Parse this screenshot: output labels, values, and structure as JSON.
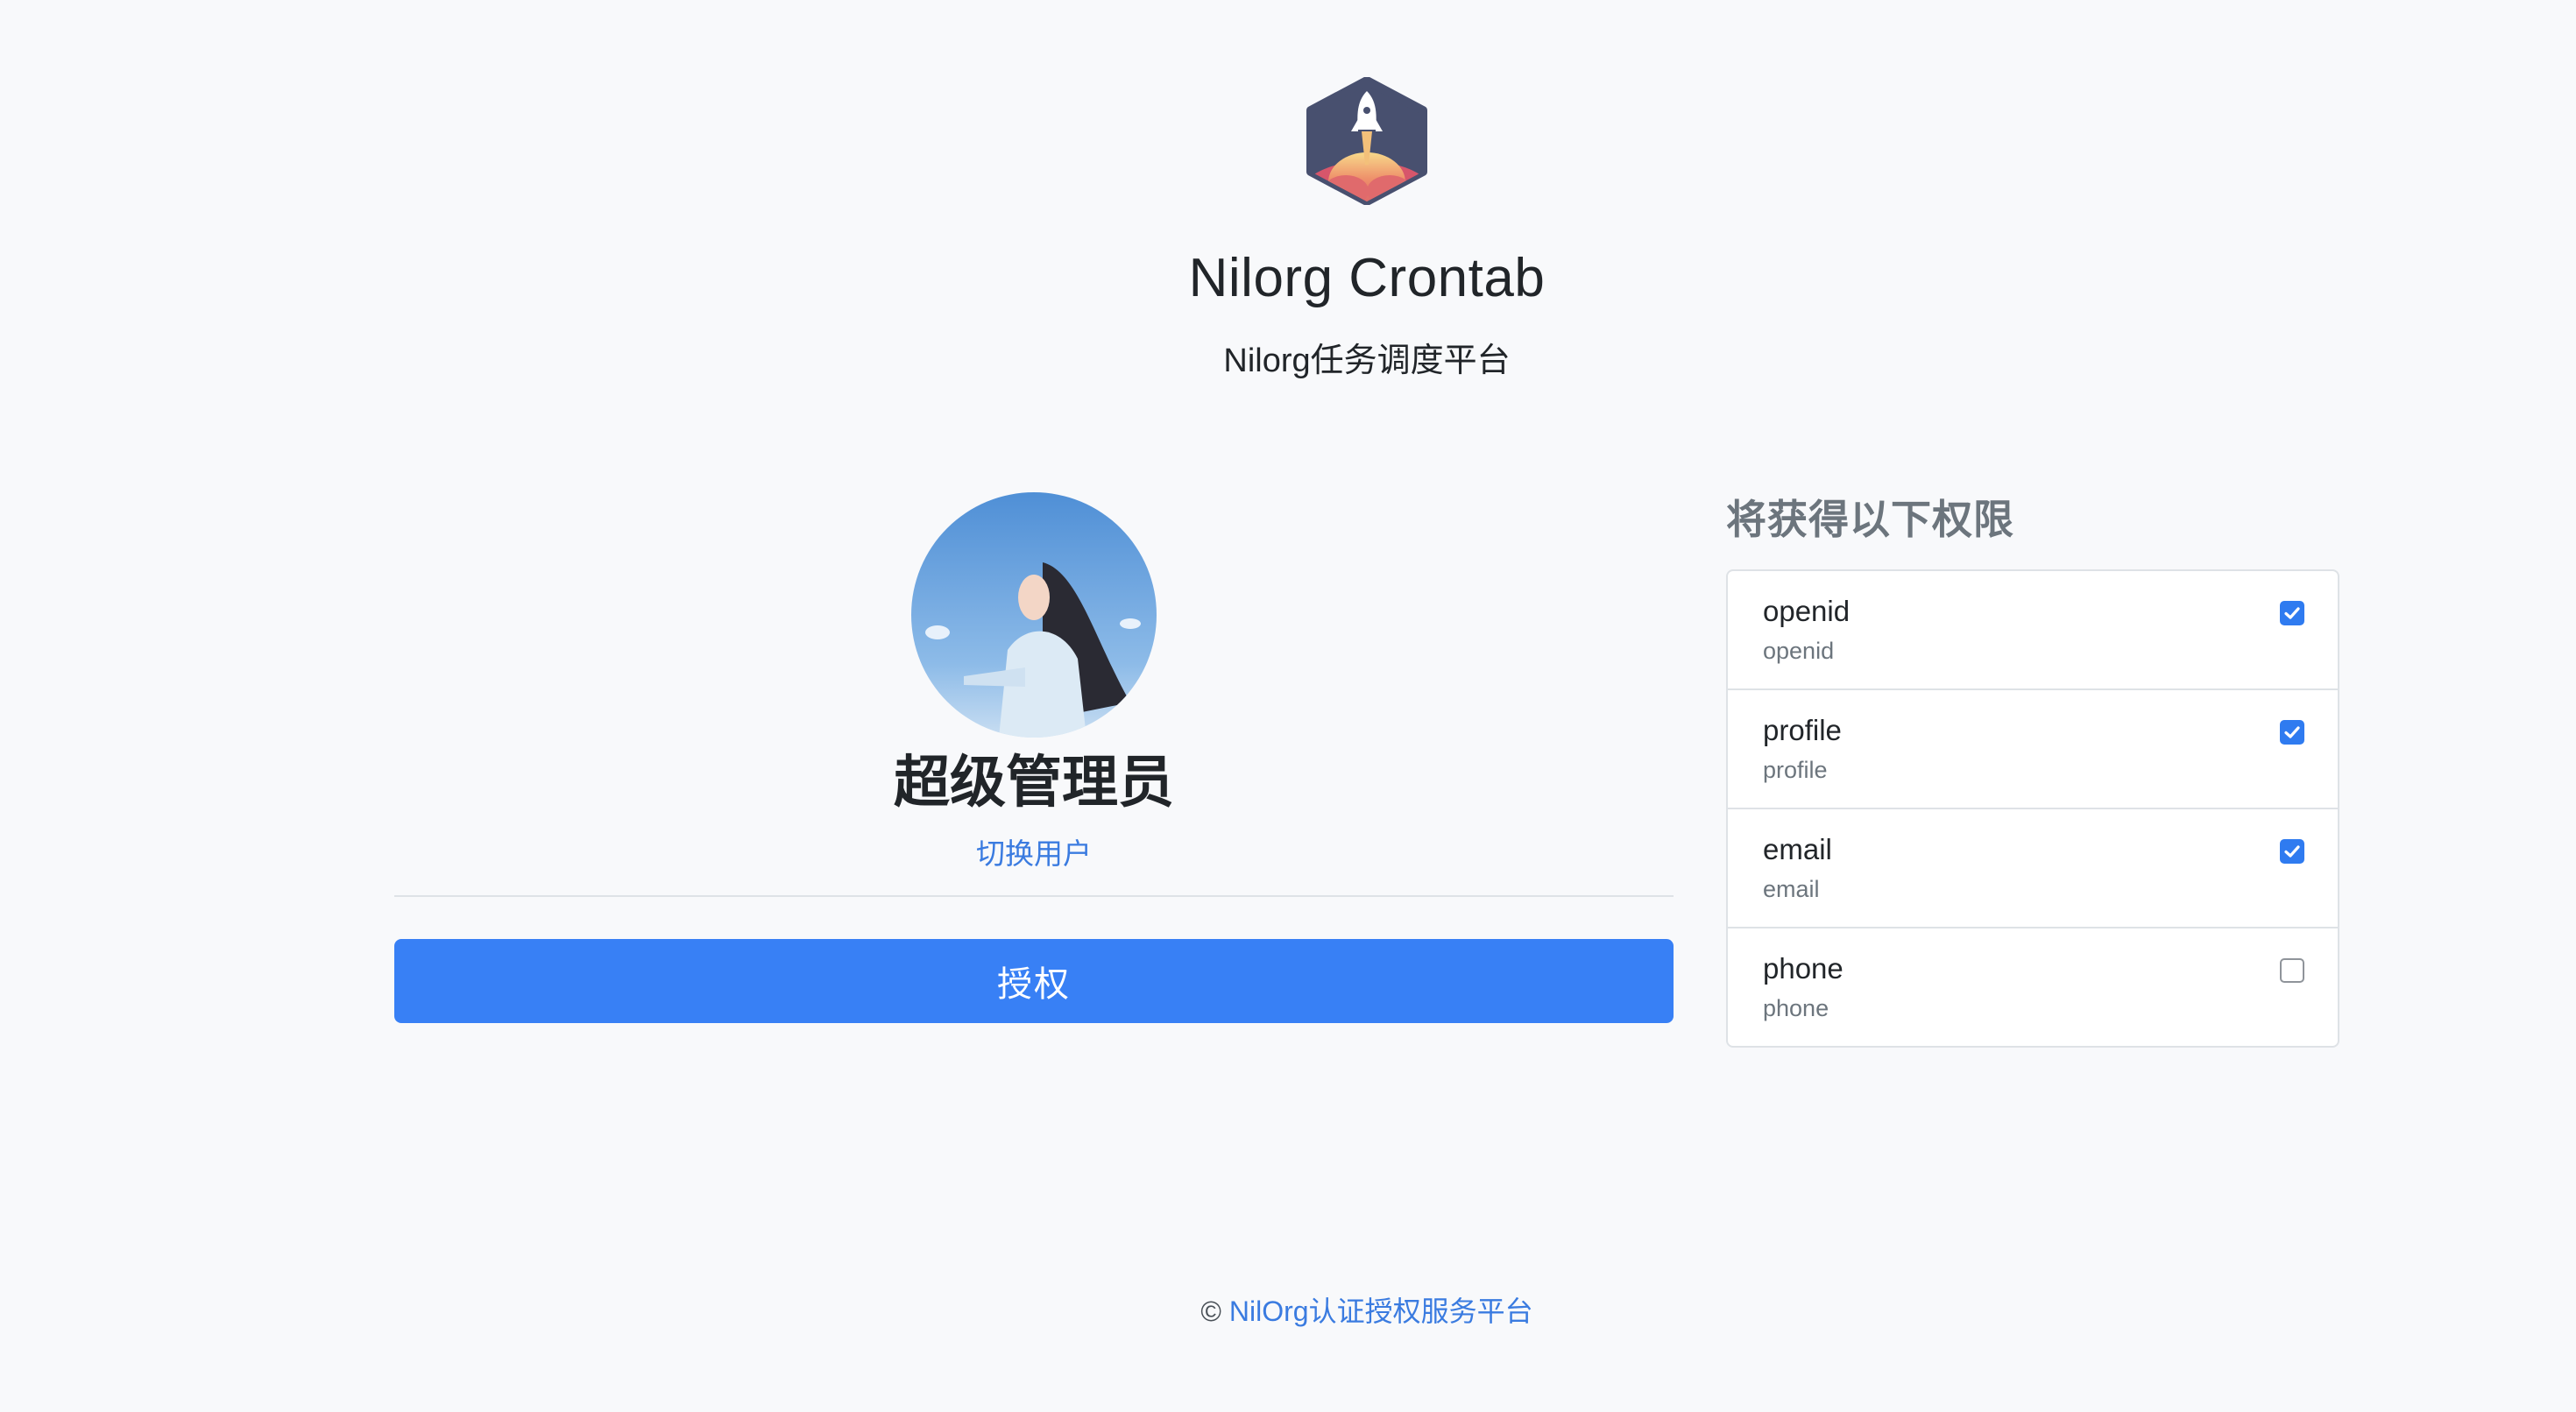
{
  "header": {
    "logo_icon": "rocket-hexagon-icon",
    "title": "Nilorg Crontab",
    "subtitle": "Nilorg任务调度平台"
  },
  "user": {
    "avatar_icon": "user-avatar-photo",
    "name": "超级管理员",
    "switch_label": "切换用户"
  },
  "authorize_button": {
    "label": "授权"
  },
  "scopes": {
    "heading": "将获得以下权限",
    "items": [
      {
        "name": "openid",
        "description": "openid",
        "checked": true
      },
      {
        "name": "profile",
        "description": "profile",
        "checked": true
      },
      {
        "name": "email",
        "description": "email",
        "checked": true
      },
      {
        "name": "phone",
        "description": "phone",
        "checked": false
      }
    ]
  },
  "footer": {
    "symbol": "©",
    "link_text": "NilOrg认证授权服务平台"
  },
  "colors": {
    "primary": "#3880f5",
    "link": "#3a7be0",
    "background": "#f8f9fb",
    "muted": "#6c757d",
    "border": "#dee2e6"
  }
}
